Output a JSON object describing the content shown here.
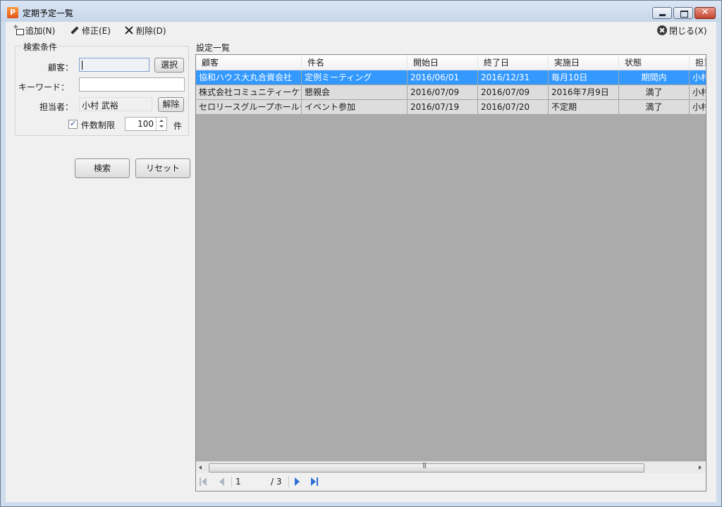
{
  "window": {
    "title": "定期予定一覧",
    "icon_letter": "P"
  },
  "toolbar": {
    "add_label": "追加(N)",
    "edit_label": "修正(E)",
    "delete_label": "削除(D)",
    "close_label": "閉じる(X)"
  },
  "search": {
    "group_title": "検索条件",
    "customer_label": "顧客：",
    "customer_value": "",
    "select_button": "選択",
    "keyword_label": "キーワード：",
    "keyword_value": "",
    "staff_label": "担当者：",
    "staff_value": "小村 武裕",
    "clear_button": "解除",
    "limit_label": "件数制限",
    "limit_checked": true,
    "limit_value": "100",
    "limit_unit": "件",
    "search_button": "検索",
    "reset_button": "リセット"
  },
  "list": {
    "label": "設定一覧",
    "columns": [
      "顧客",
      "件名",
      "開始日",
      "終了日",
      "実施日",
      "状態",
      "担当"
    ],
    "rows": [
      [
        "協和ハウス大丸合資会社",
        "定例ミーティング",
        "2016/06/01",
        "2016/12/31",
        "毎月10日",
        "期間内",
        "小村"
      ],
      [
        "株式会社コミュニティーケア...",
        "懇親会",
        "2016/07/09",
        "2016/07/09",
        "2016年7月9日",
        "満了",
        "小村"
      ],
      [
        "セロリースグループホールディ...",
        "イベント参加",
        "2016/07/19",
        "2016/07/20",
        "不定期",
        "満了",
        "小村"
      ]
    ],
    "selected_row": 0
  },
  "pager": {
    "current_page": "1",
    "total": "/ 3"
  },
  "colors": {
    "selection": "#3399ff",
    "grid_bg": "#ababab",
    "row_bg": "#dddddd"
  }
}
